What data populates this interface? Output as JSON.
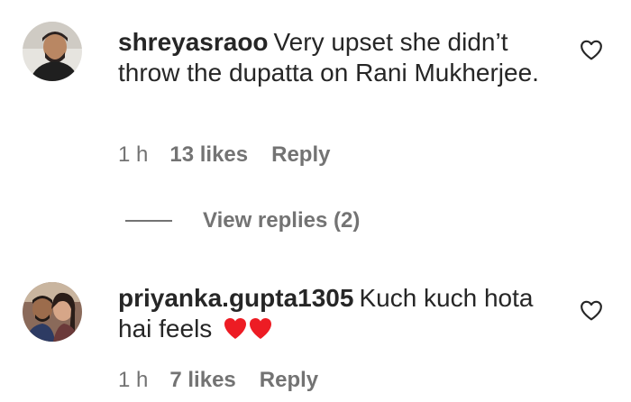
{
  "comments": [
    {
      "username": "shreyasraoo",
      "text": "Very upset she didn’t throw the dupatta on Rani Mukherjee.",
      "time": "1 h",
      "likes": "13 likes",
      "reply": "Reply",
      "view_replies": "View replies (2)"
    },
    {
      "username": "priyanka.gupta1305",
      "text": "Kuch kuch hota hai feels",
      "emoji": "❤️❤️",
      "time": "1 h",
      "likes": "7 likes",
      "reply": "Reply"
    }
  ],
  "icons": {
    "like": "heart-outline-icon",
    "emoji": "red-heart-emoji"
  },
  "colors": {
    "text": "#262626",
    "secondary": "#737373",
    "heart": "#ed1c24"
  }
}
